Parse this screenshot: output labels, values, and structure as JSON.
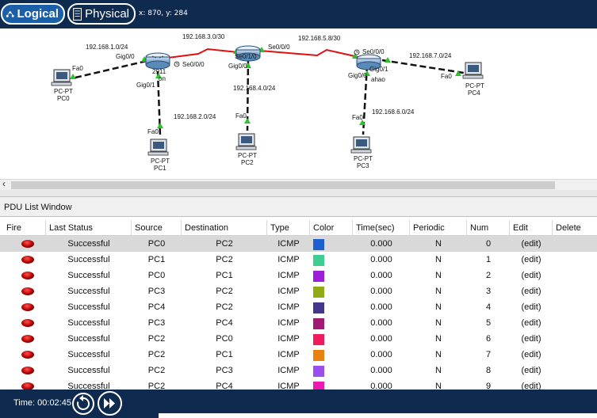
{
  "topbar": {
    "logical_label": "Logical",
    "physical_label": "Physical",
    "coords": "x: 870, y: 284"
  },
  "topology": {
    "devices": {
      "router1": {
        "model": "2911",
        "name_partial": "on"
      },
      "router2": {
        "model": "",
        "name_partial": ""
      },
      "router3": {
        "model": "",
        "name_partial": "ahao"
      },
      "pc0": {
        "type": "PC-PT",
        "name": "PC0"
      },
      "pc1": {
        "type": "PC-PT",
        "name": "PC1"
      },
      "pc2": {
        "type": "PC-PT",
        "name": "PC2"
      },
      "pc3": {
        "type": "PC-PT",
        "name": "PC3"
      },
      "pc4": {
        "type": "PC-PT",
        "name": "PC4"
      }
    },
    "networks": {
      "n1": "192.168.1.0/24",
      "n2": "192.168.2.0/24",
      "n3": "192.168.3.0/30",
      "n4": "192.168.4.0/24",
      "n5": "192.168.5.8/30",
      "n6": "192.168.6.0/24",
      "n7": "192.168.7.0/24"
    },
    "interfaces": {
      "r1_g00": "Gig0/0",
      "r1_g01": "Gig0/1",
      "r1_s000": "Se0/0/0",
      "r2_s010": "Se0/1/0",
      "r2_s000": "Se0/0/0",
      "r2_g00": "Gig0/0",
      "r3_s000": "Se0/0/0",
      "r3_g01": "Gig0/1",
      "r3_g00": "Gig0/0",
      "pc0_fa0": "Fa0",
      "pc1_fa0": "Fa0",
      "pc2_fa0": "Fa0",
      "pc3_fa0": "Fa0",
      "pc4_fa0": "Fa0"
    }
  },
  "pdu": {
    "window_title": "PDU List Window",
    "columns": [
      "Fire",
      "Last Status",
      "Source",
      "Destination",
      "Type",
      "Color",
      "Time(sec)",
      "Periodic",
      "Num",
      "Edit",
      "Delete"
    ],
    "rows": [
      {
        "status": "Successful",
        "source": "PC0",
        "destination": "PC2",
        "type": "ICMP",
        "color": "#1e5fd0",
        "time": "0.000",
        "periodic": "N",
        "num": "0",
        "edit": "(edit)"
      },
      {
        "status": "Successful",
        "source": "PC1",
        "destination": "PC2",
        "type": "ICMP",
        "color": "#3ccf8f",
        "time": "0.000",
        "periodic": "N",
        "num": "1",
        "edit": "(edit)"
      },
      {
        "status": "Successful",
        "source": "PC0",
        "destination": "PC1",
        "type": "ICMP",
        "color": "#9c1ed8",
        "time": "0.000",
        "periodic": "N",
        "num": "2",
        "edit": "(edit)"
      },
      {
        "status": "Successful",
        "source": "PC3",
        "destination": "PC2",
        "type": "ICMP",
        "color": "#8faa12",
        "time": "0.000",
        "periodic": "N",
        "num": "3",
        "edit": "(edit)"
      },
      {
        "status": "Successful",
        "source": "PC4",
        "destination": "PC2",
        "type": "ICMP",
        "color": "#44368a",
        "time": "0.000",
        "periodic": "N",
        "num": "4",
        "edit": "(edit)"
      },
      {
        "status": "Successful",
        "source": "PC3",
        "destination": "PC4",
        "type": "ICMP",
        "color": "#a11a73",
        "time": "0.000",
        "periodic": "N",
        "num": "5",
        "edit": "(edit)"
      },
      {
        "status": "Successful",
        "source": "PC2",
        "destination": "PC0",
        "type": "ICMP",
        "color": "#f01a5e",
        "time": "0.000",
        "periodic": "N",
        "num": "6",
        "edit": "(edit)"
      },
      {
        "status": "Successful",
        "source": "PC2",
        "destination": "PC1",
        "type": "ICMP",
        "color": "#e8820e",
        "time": "0.000",
        "periodic": "N",
        "num": "7",
        "edit": "(edit)"
      },
      {
        "status": "Successful",
        "source": "PC2",
        "destination": "PC3",
        "type": "ICMP",
        "color": "#9a4ef0",
        "time": "0.000",
        "periodic": "N",
        "num": "8",
        "edit": "(edit)"
      },
      {
        "status": "Successful",
        "source": "PC2",
        "destination": "PC4",
        "type": "ICMP",
        "color": "#ee1ab0",
        "time": "0.000",
        "periodic": "N",
        "num": "9",
        "edit": "(edit)"
      }
    ]
  },
  "bottombar": {
    "time_label": "Time: 00:02:45"
  }
}
